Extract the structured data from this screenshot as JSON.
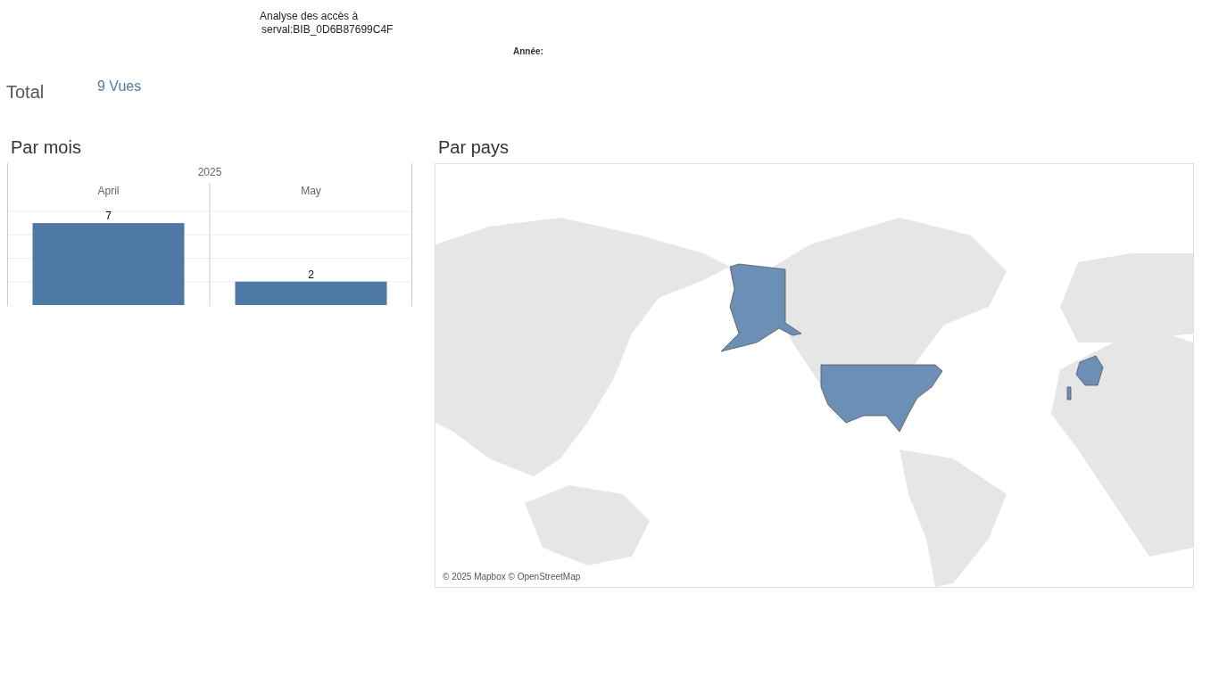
{
  "header": {
    "title_line_1": "Analyse des accès à",
    "title_line_2": "serval:BIB_0D6B87699C4F",
    "year_filter_label": "Année:"
  },
  "total": {
    "label": "Total",
    "value": "9 Vues"
  },
  "by_month": {
    "title": "Par mois",
    "chart_data": {
      "type": "bar",
      "title": "2025",
      "categories": [
        "April",
        "May"
      ],
      "values": [
        7,
        2
      ],
      "ylim": [
        0,
        8
      ],
      "data_labels": true
    }
  },
  "by_country": {
    "title": "Par pays",
    "attribution": "© 2025 Mapbox © OpenStreetMap"
  }
}
